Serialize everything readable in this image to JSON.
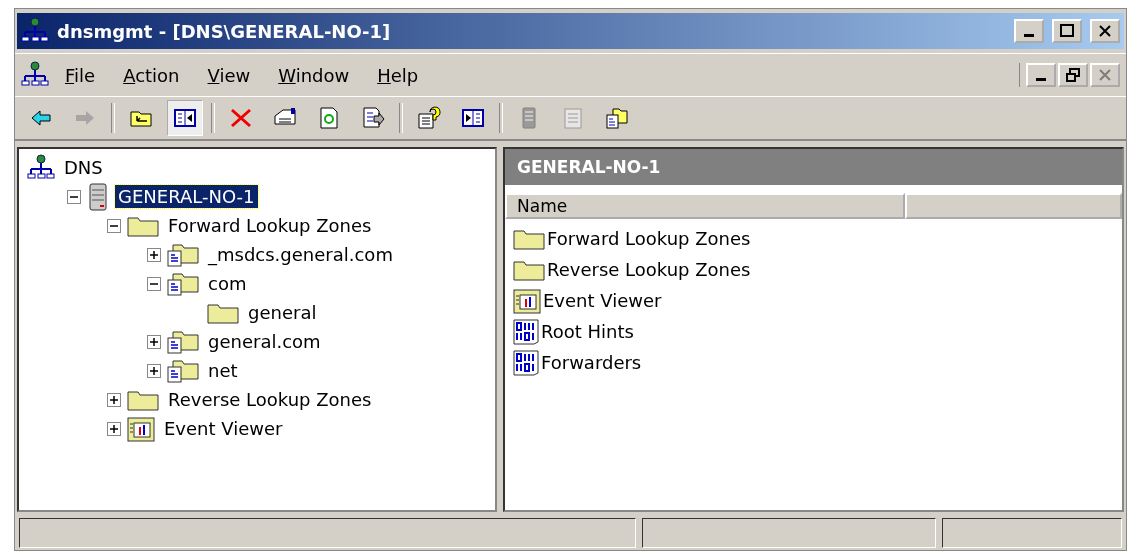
{
  "window": {
    "title": "dnsmgmt - [DNS\\GENERAL-NO-1]"
  },
  "menu": [
    "File",
    "Action",
    "View",
    "Window",
    "Help"
  ],
  "toolbar": [
    {
      "kind": "back",
      "disabled": false,
      "pressed": false
    },
    {
      "kind": "forward",
      "disabled": true,
      "pressed": false
    },
    {
      "kind": "sep"
    },
    {
      "kind": "up",
      "disabled": false,
      "pressed": false
    },
    {
      "kind": "tree",
      "disabled": false,
      "pressed": true
    },
    {
      "kind": "sep"
    },
    {
      "kind": "delete",
      "disabled": false,
      "pressed": false
    },
    {
      "kind": "properties",
      "disabled": false,
      "pressed": false
    },
    {
      "kind": "refresh",
      "disabled": false,
      "pressed": false
    },
    {
      "kind": "export",
      "disabled": false,
      "pressed": false
    },
    {
      "kind": "sep"
    },
    {
      "kind": "help",
      "disabled": false,
      "pressed": false
    },
    {
      "kind": "console",
      "disabled": false,
      "pressed": false
    },
    {
      "kind": "sep"
    },
    {
      "kind": "record",
      "disabled": true,
      "pressed": false
    },
    {
      "kind": "note",
      "disabled": true,
      "pressed": false
    },
    {
      "kind": "newzone",
      "disabled": false,
      "pressed": false
    }
  ],
  "tree": {
    "label": "DNS",
    "kind": "dns",
    "children": [
      {
        "label": "GENERAL-NO-1",
        "kind": "server",
        "selected": true,
        "expanded": true,
        "children": [
          {
            "label": "Forward Lookup Zones",
            "kind": "folder",
            "selected": false,
            "expanded": true,
            "children": [
              {
                "label": "_msdcs.general.com",
                "kind": "zone",
                "selected": false,
                "expanded": false
              },
              {
                "label": "com",
                "kind": "zone",
                "selected": false,
                "expanded": true,
                "children": [
                  {
                    "label": "general",
                    "kind": "folder",
                    "selected": false
                  }
                ]
              },
              {
                "label": "general.com",
                "kind": "zone",
                "selected": false,
                "expanded": false
              },
              {
                "label": "net",
                "kind": "zone",
                "selected": false,
                "expanded": false
              }
            ]
          },
          {
            "label": "Reverse Lookup Zones",
            "kind": "folder",
            "selected": false,
            "expanded": false
          },
          {
            "label": "Event Viewer",
            "kind": "events",
            "selected": false,
            "expanded": false
          }
        ]
      }
    ]
  },
  "details": {
    "title": "GENERAL-NO-1",
    "columns": [
      "Name"
    ],
    "items": [
      {
        "label": "Forward Lookup Zones",
        "kind": "folder"
      },
      {
        "label": "Reverse Lookup Zones",
        "kind": "folder"
      },
      {
        "label": "Event Viewer",
        "kind": "events"
      },
      {
        "label": "Root Hints",
        "kind": "hints"
      },
      {
        "label": "Forwarders",
        "kind": "hints"
      }
    ]
  }
}
